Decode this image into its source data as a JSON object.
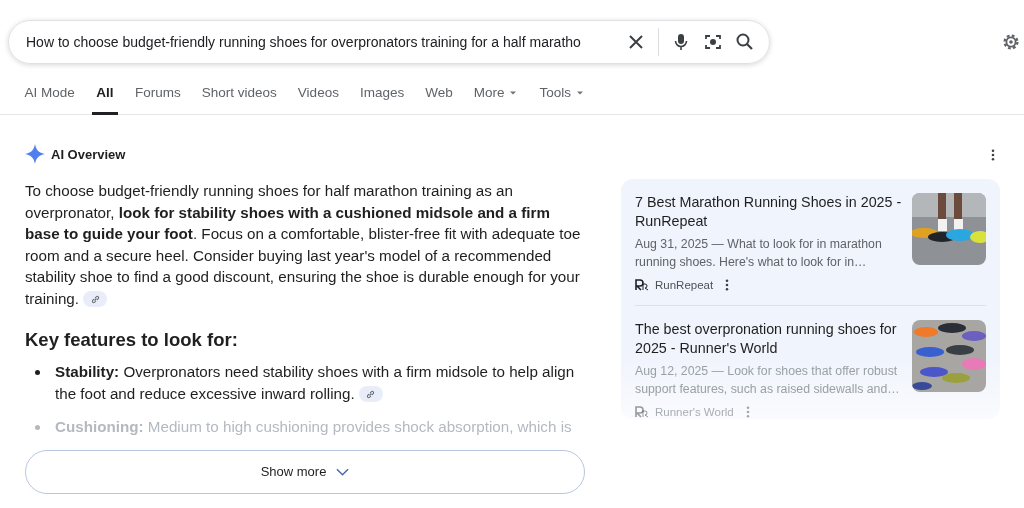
{
  "search": {
    "value": "How to choose budget-friendly running shoes for overpronators training for a half maratho"
  },
  "tabs": [
    {
      "label": "AI Mode",
      "selected": false,
      "dropdown": false
    },
    {
      "label": "All",
      "selected": true,
      "dropdown": false
    },
    {
      "label": "Forums",
      "selected": false,
      "dropdown": false
    },
    {
      "label": "Short videos",
      "selected": false,
      "dropdown": false
    },
    {
      "label": "Videos",
      "selected": false,
      "dropdown": false
    },
    {
      "label": "Images",
      "selected": false,
      "dropdown": false
    },
    {
      "label": "Web",
      "selected": false,
      "dropdown": false
    },
    {
      "label": "More",
      "selected": false,
      "dropdown": true
    },
    {
      "label": "Tools",
      "selected": false,
      "dropdown": true
    }
  ],
  "overview": {
    "title": "AI Overview",
    "summary": "To choose budget-friendly running shoes for half marathon training as an overpronator, **look for stability shoes with a cushioned midsole and a firm base to guide your foot**. Focus on a comfortable, blister-free fit with adequate toe room and a secure heel. Consider buying last year's model of a recommended stability shoe to find a good discount, ensuring the shoe is durable enough for your training.",
    "heading": "Key features to look for:",
    "features": [
      {
        "term": "Stability:",
        "text": "Overpronators need stability shoes with a firm midsole to help align the foot and reduce excessive inward rolling.",
        "faded": false
      },
      {
        "term": "Cushioning:",
        "text": "Medium to high cushioning provides shock absorption, which is",
        "faded": true
      }
    ],
    "show_more": "Show more",
    "sources": [
      {
        "title": "7 Best Marathon Running Shoes in 2025 - RunRepeat",
        "snippet": "Aug 31, 2025 — What to look for in marathon running shoes. Here's what to look for in…",
        "site": "RunRepeat",
        "faded": false
      },
      {
        "title": "The best overpronation running shoes for 2025 - Runner's World",
        "snippet": "Aug 12, 2025 — Look for shoes that offer robust support features, such as raised sidewalls and…",
        "site": "Runner's World",
        "faded": true
      }
    ]
  }
}
